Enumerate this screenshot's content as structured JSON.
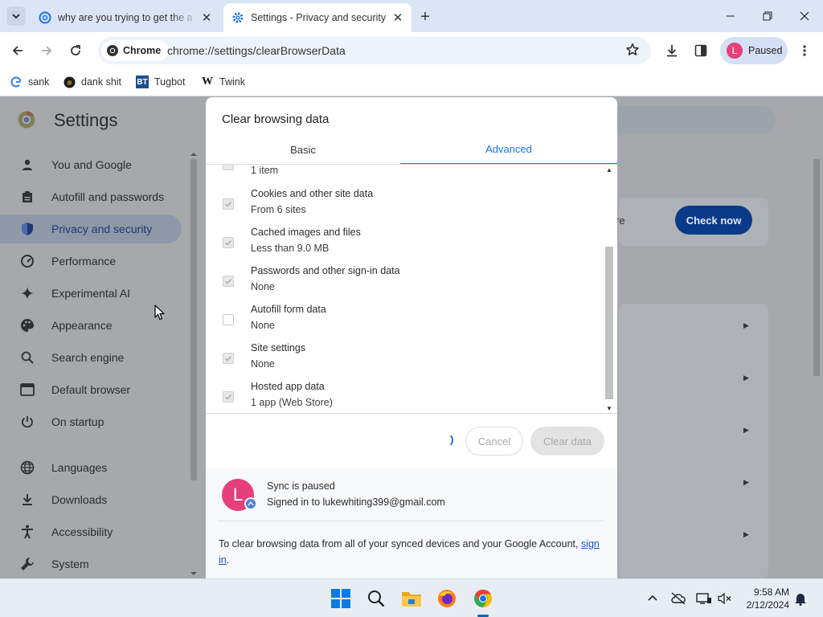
{
  "browser": {
    "tabs": [
      {
        "title": "why are you trying to get the a",
        "active": false
      },
      {
        "title": "Settings - Privacy and security",
        "active": true
      }
    ],
    "chip_label": "Chrome",
    "url": "chrome://settings/clearBrowserData",
    "profile_label": "Paused",
    "profile_initial": "L"
  },
  "bookmarks": [
    {
      "label": "sank",
      "icon": "google-icon"
    },
    {
      "label": "dank shit",
      "icon": "favicon"
    },
    {
      "label": "Tugbot",
      "icon": "BT"
    },
    {
      "label": "Twink",
      "icon": "W"
    }
  ],
  "settings": {
    "title": "Settings",
    "nav": [
      {
        "label": "You and Google",
        "icon": "person-icon"
      },
      {
        "label": "Autofill and passwords",
        "icon": "clipboard-icon"
      },
      {
        "label": "Privacy and security",
        "icon": "shield-icon",
        "active": true
      },
      {
        "label": "Performance",
        "icon": "speedometer-icon"
      },
      {
        "label": "Experimental AI",
        "icon": "sparkle-icon"
      },
      {
        "label": "Appearance",
        "icon": "palette-icon"
      },
      {
        "label": "Search engine",
        "icon": "search-icon"
      },
      {
        "label": "Default browser",
        "icon": "browser-icon"
      },
      {
        "label": "On startup",
        "icon": "power-icon"
      },
      {
        "label": "Languages",
        "icon": "globe-icon"
      },
      {
        "label": "Downloads",
        "icon": "download-icon"
      },
      {
        "label": "Accessibility",
        "icon": "accessibility-icon"
      },
      {
        "label": "System",
        "icon": "wrench-icon"
      }
    ],
    "check_now": "Check now",
    "partial_text": "re"
  },
  "dialog": {
    "title": "Clear browsing data",
    "tabs": {
      "basic": "Basic",
      "advanced": "Advanced"
    },
    "partial_item_sub": "1 item",
    "items": [
      {
        "title": "Cookies and other site data",
        "sub": "From 6 sites",
        "checked": true
      },
      {
        "title": "Cached images and files",
        "sub": "Less than 9.0 MB",
        "checked": true
      },
      {
        "title": "Passwords and other sign-in data",
        "sub": "None",
        "checked": true
      },
      {
        "title": "Autofill form data",
        "sub": "None",
        "checked": false
      },
      {
        "title": "Site settings",
        "sub": "None",
        "checked": true
      },
      {
        "title": "Hosted app data",
        "sub": "1 app (Web Store)",
        "checked": true
      }
    ],
    "cancel": "Cancel",
    "clear": "Clear data",
    "sync": {
      "avatar_initial": "L",
      "title": "Sync is paused",
      "signed_in": "Signed in to lukewhiting399@gmail.com"
    },
    "footer_text": "To clear browsing data from all of your synced devices and your Google Account,",
    "footer_link": "sign in",
    "footer_end": "."
  },
  "taskbar": {
    "time": "9:58 AM",
    "date": "2/12/2024"
  },
  "colors": {
    "accent": "#1a73e8",
    "profile": "#e5407a",
    "check_now_bg": "#0b3a88"
  }
}
